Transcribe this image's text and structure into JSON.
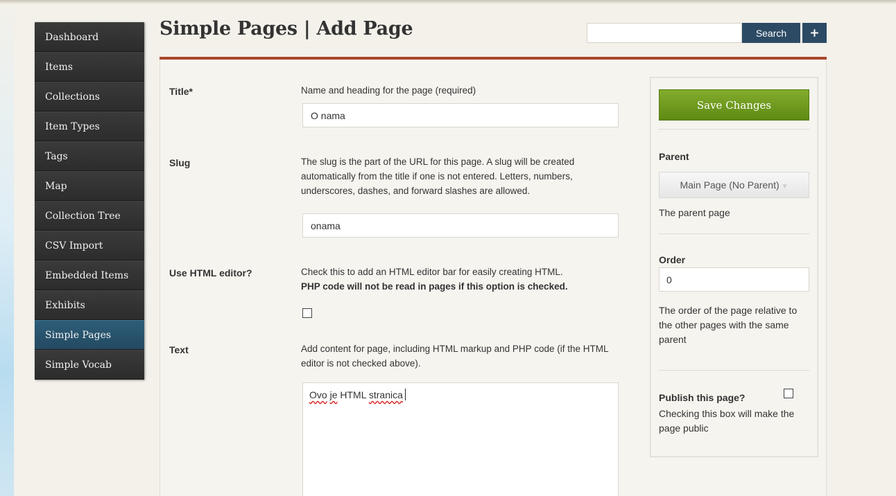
{
  "sidebar": {
    "items": [
      {
        "label": "Dashboard"
      },
      {
        "label": "Items"
      },
      {
        "label": "Collections"
      },
      {
        "label": "Item Types"
      },
      {
        "label": "Tags"
      },
      {
        "label": "Map"
      },
      {
        "label": "Collection Tree"
      },
      {
        "label": "CSV Import"
      },
      {
        "label": "Embedded Items"
      },
      {
        "label": "Exhibits"
      },
      {
        "label": "Simple Pages"
      },
      {
        "label": "Simple Vocab"
      }
    ],
    "active": "Simple Pages"
  },
  "header": {
    "title": "Simple Pages | Add Page",
    "search_value": "",
    "search_button": "Search",
    "add_button": "+"
  },
  "form": {
    "title_label": "Title*",
    "title_desc": "Name and heading for the page (required)",
    "title_value": "O nama",
    "slug_label": "Slug",
    "slug_desc": "The slug is the part of the URL for this page. A slug will be created automatically from the title if one is not entered. Letters, numbers, underscores, dashes, and forward slashes are allowed.",
    "slug_value": "onama",
    "html_editor_label": "Use HTML editor?",
    "html_editor_desc": "Check this to add an HTML editor bar for easily creating HTML.",
    "html_editor_desc_bold": "PHP code will not be read in pages if this option is checked.",
    "html_editor_checked": false,
    "text_label": "Text",
    "text_desc": "Add content for page, including HTML markup and PHP code (if the HTML editor is not checked above).",
    "text_words": [
      "Ovo",
      "je",
      "HTML",
      "stranica"
    ]
  },
  "save_panel": {
    "save_button": "Save Changes",
    "parent_label": "Parent",
    "parent_selected": "Main Page (No Parent)",
    "parent_help": "The parent page",
    "order_label": "Order",
    "order_value": "0",
    "order_help": "The order of the page relative to the other pages with the same parent",
    "publish_label": "Publish this page?",
    "publish_checked": false,
    "publish_help": "Checking this box will make the page public"
  },
  "colors": {
    "accent_rule": "#a7472b",
    "nav_active": "#2e5d78",
    "save_green": "#6f9b1f",
    "search_blue": "#2c4a64"
  }
}
